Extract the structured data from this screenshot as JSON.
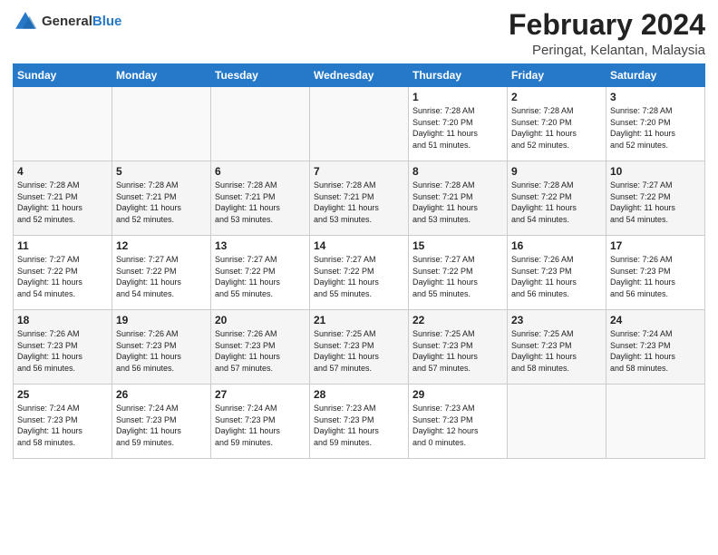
{
  "header": {
    "logo_general": "General",
    "logo_blue": "Blue",
    "month_title": "February 2024",
    "location": "Peringat, Kelantan, Malaysia"
  },
  "weekdays": [
    "Sunday",
    "Monday",
    "Tuesday",
    "Wednesday",
    "Thursday",
    "Friday",
    "Saturday"
  ],
  "weeks": [
    [
      {
        "day": "",
        "info": ""
      },
      {
        "day": "",
        "info": ""
      },
      {
        "day": "",
        "info": ""
      },
      {
        "day": "",
        "info": ""
      },
      {
        "day": "1",
        "info": "Sunrise: 7:28 AM\nSunset: 7:20 PM\nDaylight: 11 hours\nand 51 minutes."
      },
      {
        "day": "2",
        "info": "Sunrise: 7:28 AM\nSunset: 7:20 PM\nDaylight: 11 hours\nand 52 minutes."
      },
      {
        "day": "3",
        "info": "Sunrise: 7:28 AM\nSunset: 7:20 PM\nDaylight: 11 hours\nand 52 minutes."
      }
    ],
    [
      {
        "day": "4",
        "info": "Sunrise: 7:28 AM\nSunset: 7:21 PM\nDaylight: 11 hours\nand 52 minutes."
      },
      {
        "day": "5",
        "info": "Sunrise: 7:28 AM\nSunset: 7:21 PM\nDaylight: 11 hours\nand 52 minutes."
      },
      {
        "day": "6",
        "info": "Sunrise: 7:28 AM\nSunset: 7:21 PM\nDaylight: 11 hours\nand 53 minutes."
      },
      {
        "day": "7",
        "info": "Sunrise: 7:28 AM\nSunset: 7:21 PM\nDaylight: 11 hours\nand 53 minutes."
      },
      {
        "day": "8",
        "info": "Sunrise: 7:28 AM\nSunset: 7:21 PM\nDaylight: 11 hours\nand 53 minutes."
      },
      {
        "day": "9",
        "info": "Sunrise: 7:28 AM\nSunset: 7:22 PM\nDaylight: 11 hours\nand 54 minutes."
      },
      {
        "day": "10",
        "info": "Sunrise: 7:27 AM\nSunset: 7:22 PM\nDaylight: 11 hours\nand 54 minutes."
      }
    ],
    [
      {
        "day": "11",
        "info": "Sunrise: 7:27 AM\nSunset: 7:22 PM\nDaylight: 11 hours\nand 54 minutes."
      },
      {
        "day": "12",
        "info": "Sunrise: 7:27 AM\nSunset: 7:22 PM\nDaylight: 11 hours\nand 54 minutes."
      },
      {
        "day": "13",
        "info": "Sunrise: 7:27 AM\nSunset: 7:22 PM\nDaylight: 11 hours\nand 55 minutes."
      },
      {
        "day": "14",
        "info": "Sunrise: 7:27 AM\nSunset: 7:22 PM\nDaylight: 11 hours\nand 55 minutes."
      },
      {
        "day": "15",
        "info": "Sunrise: 7:27 AM\nSunset: 7:22 PM\nDaylight: 11 hours\nand 55 minutes."
      },
      {
        "day": "16",
        "info": "Sunrise: 7:26 AM\nSunset: 7:23 PM\nDaylight: 11 hours\nand 56 minutes."
      },
      {
        "day": "17",
        "info": "Sunrise: 7:26 AM\nSunset: 7:23 PM\nDaylight: 11 hours\nand 56 minutes."
      }
    ],
    [
      {
        "day": "18",
        "info": "Sunrise: 7:26 AM\nSunset: 7:23 PM\nDaylight: 11 hours\nand 56 minutes."
      },
      {
        "day": "19",
        "info": "Sunrise: 7:26 AM\nSunset: 7:23 PM\nDaylight: 11 hours\nand 56 minutes."
      },
      {
        "day": "20",
        "info": "Sunrise: 7:26 AM\nSunset: 7:23 PM\nDaylight: 11 hours\nand 57 minutes."
      },
      {
        "day": "21",
        "info": "Sunrise: 7:25 AM\nSunset: 7:23 PM\nDaylight: 11 hours\nand 57 minutes."
      },
      {
        "day": "22",
        "info": "Sunrise: 7:25 AM\nSunset: 7:23 PM\nDaylight: 11 hours\nand 57 minutes."
      },
      {
        "day": "23",
        "info": "Sunrise: 7:25 AM\nSunset: 7:23 PM\nDaylight: 11 hours\nand 58 minutes."
      },
      {
        "day": "24",
        "info": "Sunrise: 7:24 AM\nSunset: 7:23 PM\nDaylight: 11 hours\nand 58 minutes."
      }
    ],
    [
      {
        "day": "25",
        "info": "Sunrise: 7:24 AM\nSunset: 7:23 PM\nDaylight: 11 hours\nand 58 minutes."
      },
      {
        "day": "26",
        "info": "Sunrise: 7:24 AM\nSunset: 7:23 PM\nDaylight: 11 hours\nand 59 minutes."
      },
      {
        "day": "27",
        "info": "Sunrise: 7:24 AM\nSunset: 7:23 PM\nDaylight: 11 hours\nand 59 minutes."
      },
      {
        "day": "28",
        "info": "Sunrise: 7:23 AM\nSunset: 7:23 PM\nDaylight: 11 hours\nand 59 minutes."
      },
      {
        "day": "29",
        "info": "Sunrise: 7:23 AM\nSunset: 7:23 PM\nDaylight: 12 hours\nand 0 minutes."
      },
      {
        "day": "",
        "info": ""
      },
      {
        "day": "",
        "info": ""
      }
    ]
  ]
}
